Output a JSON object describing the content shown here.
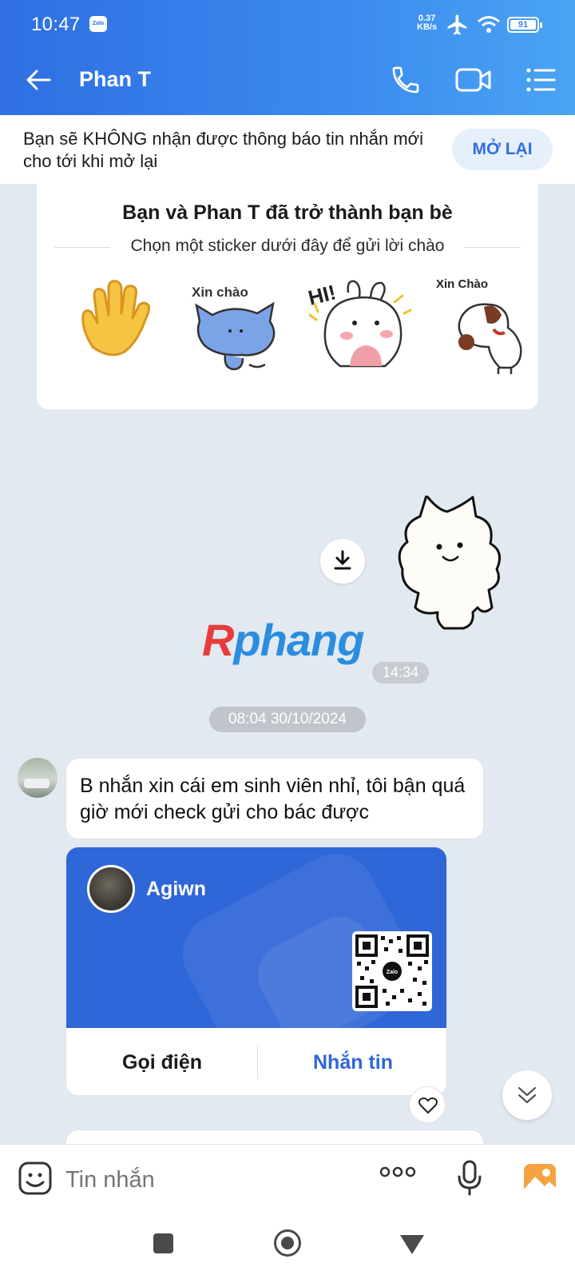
{
  "status_bar": {
    "time": "10:47",
    "app_badge": "Zalo",
    "net_speed_top": "0.37",
    "net_speed_bottom": "KB/s",
    "battery": "91"
  },
  "header": {
    "title": "Phan T",
    "icons": [
      "back-arrow-icon",
      "phone-icon",
      "video-camera-icon",
      "menu-list-icon"
    ],
    "accent": "#2f6fe2"
  },
  "notice": {
    "text": "Bạn sẽ KHÔNG nhận được thông báo tin nhắn mới cho tới khi mở lại",
    "reopen_label": "MỞ LẠI"
  },
  "friend_card": {
    "title": "Bạn và Phan T đã trở thành bạn bè",
    "subtitle": "Chọn một sticker dưới đây để gửi lời chào",
    "stickers": [
      {
        "name": "waving-hand-sticker",
        "caption": ""
      },
      {
        "name": "blue-cat-sticker",
        "caption": "Xin chào"
      },
      {
        "name": "bunny-hi-sticker",
        "caption": "HI!"
      },
      {
        "name": "puppy-sticker",
        "caption": "Xin Chào"
      }
    ]
  },
  "sent_sticker": {
    "time": "14:34",
    "watermark": "Rphang",
    "watermark_first": "R",
    "watermark_rest": "phang"
  },
  "date_divider": "08:04 30/10/2024",
  "message": {
    "text": "B nhắn xin cái em sinh viên nhỉ, tôi bận quá giờ mới check gửi cho bác được"
  },
  "contact_card": {
    "name": "Agiwn",
    "call_label": "Gọi điện",
    "message_label": "Nhắn tin",
    "qr_label": "Zalo",
    "card_color": "#2f66d8"
  },
  "composer": {
    "placeholder": "Tin nhắn"
  }
}
